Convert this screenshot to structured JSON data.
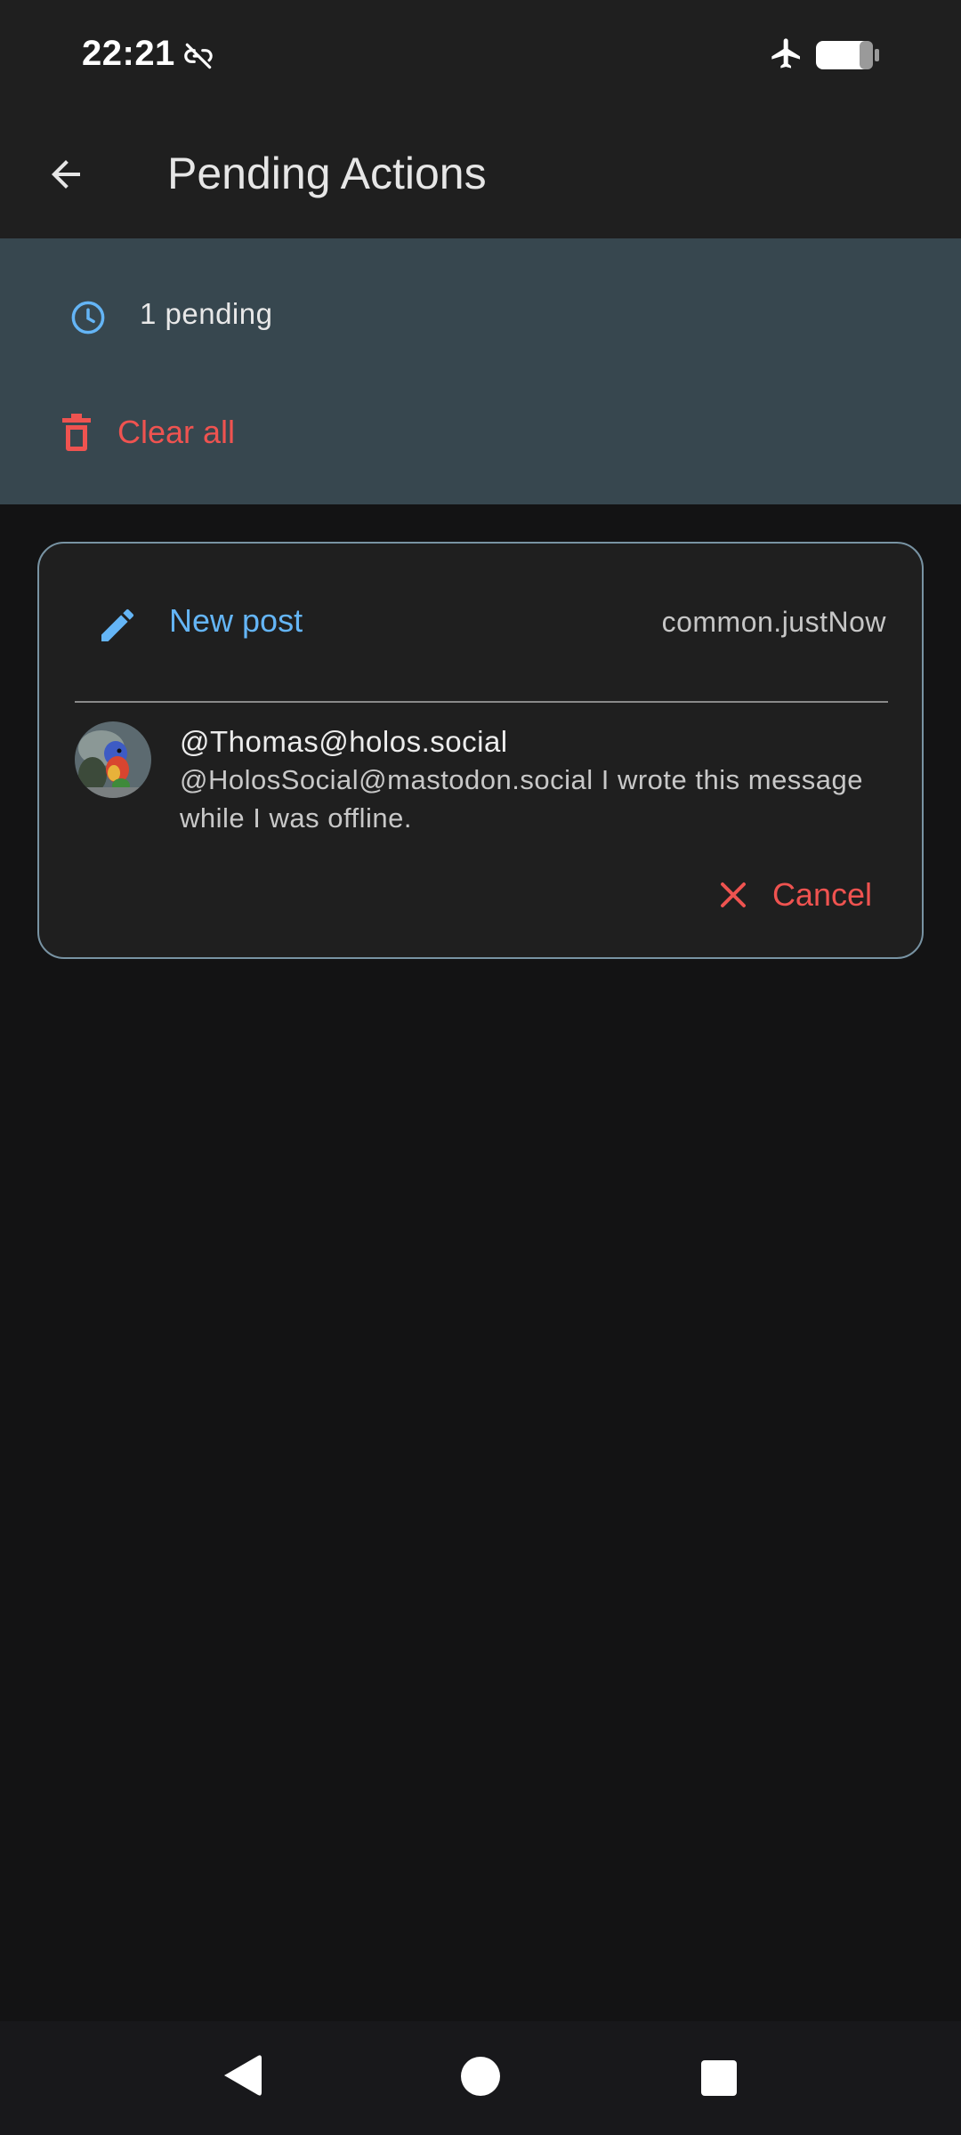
{
  "status_bar": {
    "time": "22:21",
    "icons": [
      "link-off-icon",
      "airplane-mode-icon",
      "battery-icon"
    ]
  },
  "app_bar": {
    "back_icon": "arrow-back-icon",
    "title": "Pending Actions"
  },
  "summary": {
    "icon": "clock-icon",
    "pending_count": "1 pending",
    "clear_all": {
      "icon": "trash-icon",
      "label": "Clear all"
    }
  },
  "actions": [
    {
      "type_icon": "pencil-icon",
      "type_label": "New post",
      "time": "common.justNow",
      "author": "@Thomas@holos.social",
      "content": "@HolosSocial@mastodon.social I wrote this message while I was offline.",
      "cancel": {
        "icon": "close-icon",
        "label": "Cancel"
      }
    }
  ],
  "nav_bar": {
    "items": [
      "nav-back-icon",
      "nav-home-icon",
      "nav-recents-icon"
    ]
  },
  "colors": {
    "background": "#131314",
    "app_bar": "#1f1f1f",
    "summary_panel": "#37474f",
    "accent_blue": "#64b5f6",
    "danger_red": "#ef5350",
    "card_border": "#7893a3"
  }
}
